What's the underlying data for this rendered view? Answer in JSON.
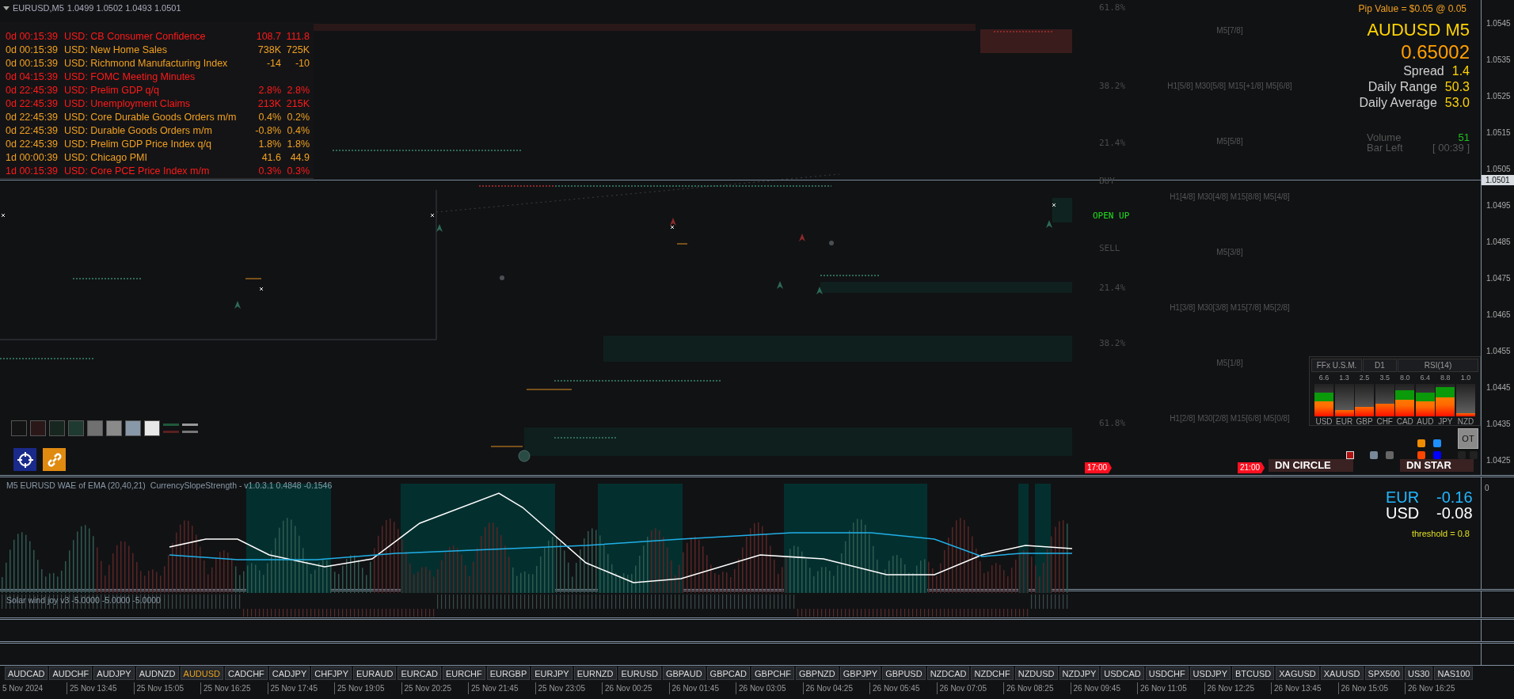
{
  "chart_header": {
    "symbol": "EURUSD,M5",
    "ohlc": "1.0499 1.0502 1.0493 1.0501"
  },
  "news": [
    {
      "time": "0d 00:15:39",
      "event": "USD: CB Consumer Confidence",
      "actual": "108.7",
      "forecast": "111.8",
      "color": "#ff1a1a"
    },
    {
      "time": "0d 00:15:39",
      "event": "USD: New Home Sales",
      "actual": "738K",
      "forecast": "725K",
      "color": "#f0a020"
    },
    {
      "time": "0d 00:15:39",
      "event": "USD: Richmond Manufacturing Index",
      "actual": "-14",
      "forecast": "-10",
      "color": "#f0a020"
    },
    {
      "time": "0d 04:15:39",
      "event": "USD: FOMC Meeting Minutes",
      "color": "#ff1a1a"
    },
    {
      "time": "0d 22:45:39",
      "event": "USD: Prelim GDP q/q",
      "actual": "2.8%",
      "forecast": "2.8%",
      "color": "#ff1a1a"
    },
    {
      "time": "0d 22:45:39",
      "event": "USD: Unemployment Claims",
      "actual": "213K",
      "forecast": "215K",
      "color": "#ff1a1a"
    },
    {
      "time": "0d 22:45:39",
      "event": "USD: Core Durable Goods Orders m/m",
      "actual": "0.4%",
      "forecast": "0.2%",
      "color": "#f0a020"
    },
    {
      "time": "0d 22:45:39",
      "event": "USD: Durable Goods Orders m/m",
      "actual": "-0.8%",
      "forecast": "0.4%",
      "color": "#f0a020"
    },
    {
      "time": "0d 22:45:39",
      "event": "USD: Prelim GDP Price Index q/q",
      "actual": "1.8%",
      "forecast": "1.8%",
      "color": "#f0a020"
    },
    {
      "time": "1d 00:00:39",
      "event": "USD: Chicago PMI",
      "actual": "41.6",
      "forecast": "44.9",
      "color": "#f0a020"
    },
    {
      "time": "1d 00:15:39",
      "event": "USD: Core PCE Price Index m/m",
      "actual": "0.3%",
      "forecast": "0.3%",
      "color": "#ff1a1a"
    }
  ],
  "info_panel": {
    "pip_value": "Pip Value = $0.05 @ 0.05",
    "symbol": "AUDUSD M5",
    "price": "0.65002",
    "stats": [
      {
        "label": "Spread",
        "value": "1.4"
      },
      {
        "label": "Daily Range",
        "value": "50.3"
      },
      {
        "label": "Daily Average",
        "value": "53.0"
      }
    ],
    "volume": {
      "label": "Volume",
      "value": "51"
    },
    "bar_left": {
      "label": "Bar Left",
      "value": "[ 00:39 ]"
    }
  },
  "price_axis": {
    "ticks": [
      "1.0545",
      "1.0535",
      "1.0525",
      "1.0515",
      "1.0505",
      "1.0495",
      "1.0485",
      "1.0475",
      "1.0465",
      "1.0455",
      "1.0445",
      "1.0435",
      "1.0425"
    ],
    "current": "1.0501"
  },
  "fib_labels": [
    "61.8%",
    "38.2%",
    "21.4%",
    "BUY",
    "SELL",
    "21.4%",
    "38.2%",
    "61.8%"
  ],
  "murrey_labels": [
    "M5[7/8]",
    "H1[5/8] M30[5/8] M15[+1/8] M5[6/8]",
    "M5[5/8]",
    "H1[4/8] M30[4/8] M15[8/8] M5[4/8]",
    "M5[3/8]",
    "H1[3/8] M30[3/8] M15[7/8] M5[2/8]",
    "M5[1/8]",
    "H1[2/8] M30[2/8] M15[6/8] M5[0/8]"
  ],
  "signal_text": "OPEN UP",
  "strength_meter": {
    "headers": [
      "FFx U.S.M.",
      "D1",
      "RSI(14)"
    ],
    "currencies": [
      {
        "name": "USD",
        "value": "6.6",
        "level": 0.72
      },
      {
        "name": "EUR",
        "value": "1.3",
        "level": 0.2
      },
      {
        "name": "GBP",
        "value": "2.5",
        "level": 0.3
      },
      {
        "name": "CHF",
        "value": "3.5",
        "level": 0.4
      },
      {
        "name": "CAD",
        "value": "8.0",
        "level": 0.8
      },
      {
        "name": "AUD",
        "value": "6.4",
        "level": 0.72
      },
      {
        "name": "JPY",
        "value": "8.8",
        "level": 0.9
      },
      {
        "name": "NZD",
        "value": "1.0",
        "level": 0.1
      }
    ]
  },
  "ot_button": "OT",
  "toggle_squares": [
    {
      "color": "#f08c00"
    },
    {
      "color": "#1e90ff"
    },
    {
      "color": "#ff4500"
    },
    {
      "color": "#0000ff"
    }
  ],
  "time_markers": [
    "17:00",
    "21:00"
  ],
  "patterns": [
    "DN CIRCLE",
    "DN STAR"
  ],
  "swatches": [
    {
      "color": "#141414"
    },
    {
      "color": "#2a1818"
    },
    {
      "color": "#182620"
    },
    {
      "color": "#1f3a30"
    },
    {
      "color": "#707070"
    },
    {
      "color": "#8a8a8a"
    },
    {
      "color": "#8898a8"
    },
    {
      "color": "#e8e8e8"
    }
  ],
  "indicator": {
    "title": "M5 EURUSD WAE of EMA (20,40,21)",
    "subtitle": "CurrencySlopeStrength - v1.0.3.1 0.4848 -0.1546",
    "axis_zero": "0",
    "readouts": [
      {
        "currency": "EUR",
        "value": "-0.16",
        "color": "#20b8ff"
      },
      {
        "currency": "USD",
        "value": "-0.08",
        "color": "#ffffff"
      }
    ],
    "threshold": "threshold = 0.8"
  },
  "solar_wind": {
    "title": "Solar wind joy v3 -5.0000 -5.0000 -5.0000"
  },
  "symbol_tabs": [
    {
      "label": "AUDCAD",
      "selected": false
    },
    {
      "label": "AUDCHF",
      "selected": false
    },
    {
      "label": "AUDJPY",
      "selected": false
    },
    {
      "label": "AUDNZD",
      "selected": false
    },
    {
      "label": "AUDUSD",
      "selected": true
    },
    {
      "label": "CADCHF",
      "selected": false
    },
    {
      "label": "CADJPY",
      "selected": false
    },
    {
      "label": "CHFJPY",
      "selected": false
    },
    {
      "label": "EURAUD",
      "selected": false
    },
    {
      "label": "EURCAD",
      "selected": false
    },
    {
      "label": "EURCHF",
      "selected": false
    },
    {
      "label": "EURGBP",
      "selected": false
    },
    {
      "label": "EURJPY",
      "selected": false
    },
    {
      "label": "EURNZD",
      "selected": false
    },
    {
      "label": "EURUSD",
      "selected": false
    },
    {
      "label": "GBPAUD",
      "selected": false
    },
    {
      "label": "GBPCAD",
      "selected": false
    },
    {
      "label": "GBPCHF",
      "selected": false
    },
    {
      "label": "GBPNZD",
      "selected": false
    },
    {
      "label": "GBPJPY",
      "selected": false
    },
    {
      "label": "GBPUSD",
      "selected": false
    },
    {
      "label": "NZDCAD",
      "selected": false
    },
    {
      "label": "NZDCHF",
      "selected": false
    },
    {
      "label": "NZDUSD",
      "selected": false
    },
    {
      "label": "NZDJPY",
      "selected": false
    },
    {
      "label": "USDCAD",
      "selected": false
    },
    {
      "label": "USDCHF",
      "selected": false
    },
    {
      "label": "USDJPY",
      "selected": false
    },
    {
      "label": "BTCUSD",
      "selected": false
    },
    {
      "label": "XAGUSD",
      "selected": false
    },
    {
      "label": "XAUUSD",
      "selected": false
    },
    {
      "label": "SPX500",
      "selected": false
    },
    {
      "label": "US30",
      "selected": false
    },
    {
      "label": "NAS100",
      "selected": false
    }
  ],
  "time_axis": [
    "5 Nov 2024",
    "25 Nov 13:45",
    "25 Nov 15:05",
    "25 Nov 16:25",
    "25 Nov 17:45",
    "25 Nov 19:05",
    "25 Nov 20:25",
    "25 Nov 21:45",
    "25 Nov 23:05",
    "26 Nov 00:25",
    "26 Nov 01:45",
    "26 Nov 03:05",
    "26 Nov 04:25",
    "26 Nov 05:45",
    "26 Nov 07:05",
    "26 Nov 08:25",
    "26 Nov 09:45",
    "26 Nov 11:05",
    "26 Nov 12:25",
    "26 Nov 13:45",
    "26 Nov 15:05",
    "26 Nov 16:25"
  ]
}
